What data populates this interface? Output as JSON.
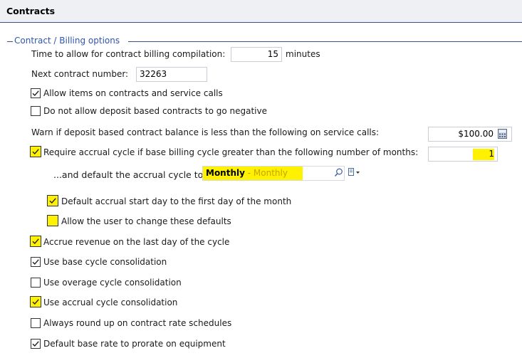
{
  "header": {
    "title": "Contracts"
  },
  "group": {
    "label": "Contract / Billing options"
  },
  "billing_compilation": {
    "label": "Time to allow for contract billing compilation:",
    "value": "15",
    "unit": "minutes"
  },
  "next_contract": {
    "label": "Next contract number:",
    "value": "32263"
  },
  "options": {
    "allow_items": {
      "label": "Allow items on contracts and service calls",
      "checked": true
    },
    "no_negative_deposit": {
      "label": "Do not allow deposit based contracts to go negative",
      "checked": false
    },
    "require_accrual": {
      "label": "Require accrual cycle if base billing cycle greater than the following number of months:",
      "checked": true,
      "value": "1"
    },
    "default_start_day": {
      "label": "Default accrual start day to the first day of the month",
      "checked": true
    },
    "allow_user_change": {
      "label": "Allow the user to change these defaults",
      "checked": false
    },
    "accrue_last_day": {
      "label": "Accrue revenue on the last day of the cycle",
      "checked": true
    },
    "base_cycle": {
      "label": "Use base cycle consolidation",
      "checked": true
    },
    "overage_cycle": {
      "label": "Use overage cycle consolidation",
      "checked": false
    },
    "accrual_cycle": {
      "label": "Use accrual cycle consolidation",
      "checked": true
    },
    "round_up": {
      "label": "Always round up on contract rate schedules",
      "checked": false
    },
    "prorate": {
      "label": "Default base rate to prorate on equipment",
      "checked": true
    }
  },
  "warn_balance": {
    "label": "Warn if deposit based contract balance is less than the following on service calls:",
    "value": "$100.00"
  },
  "default_accrual": {
    "label": "...and default the accrual cycle to:",
    "value_bold": "Monthly",
    "value_rest": " - Monthly"
  },
  "colors": {
    "highlight": "#fff200",
    "group_label": "#2f55b0",
    "rule": "#3c4f8c"
  },
  "icons": {
    "calculator": "calculator-icon",
    "search": "search-icon",
    "dropdown": "dropdown-icon",
    "check": "check-icon"
  }
}
